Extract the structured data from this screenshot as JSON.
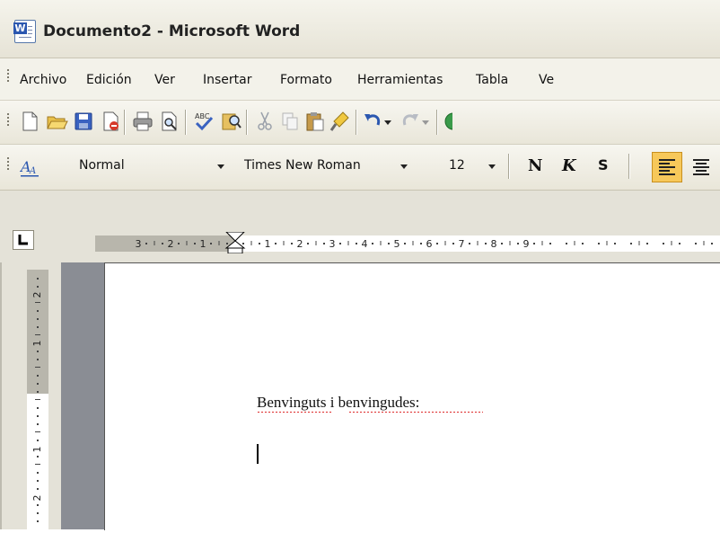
{
  "window": {
    "title": "Documento2 - Microsoft Word"
  },
  "menu": {
    "items": [
      "Archivo",
      "Edición",
      "Ver",
      "Insertar",
      "Formato",
      "Herramientas",
      "Tabla",
      "Ve"
    ]
  },
  "format_toolbar": {
    "style_value": "Normal",
    "font_value": "Times New Roman",
    "size_value": "12",
    "bold_label": "N",
    "italic_label": "K",
    "underline_label": "S"
  },
  "ruler": {
    "labels": [
      "3",
      "2",
      "1",
      "1",
      "2",
      "3",
      "4",
      "5",
      "6",
      "7",
      "8",
      "9"
    ],
    "vertical_labels": [
      "2",
      "1",
      "1",
      "2"
    ]
  },
  "document": {
    "text": "Benvinguts i benvingudes:"
  },
  "icons": {
    "app": "word-app-icon",
    "toolbar": [
      "new-document-icon",
      "open-folder-icon",
      "save-icon",
      "permission-icon",
      "print-icon",
      "print-preview-icon",
      "spelling-icon",
      "research-icon",
      "cut-icon",
      "copy-icon",
      "paste-icon",
      "format-painter-icon",
      "undo-icon",
      "redo-icon"
    ]
  },
  "colors": {
    "accent": "#f7c85a",
    "document_background": "#8a8d94",
    "spell_error": "#dd2222"
  }
}
